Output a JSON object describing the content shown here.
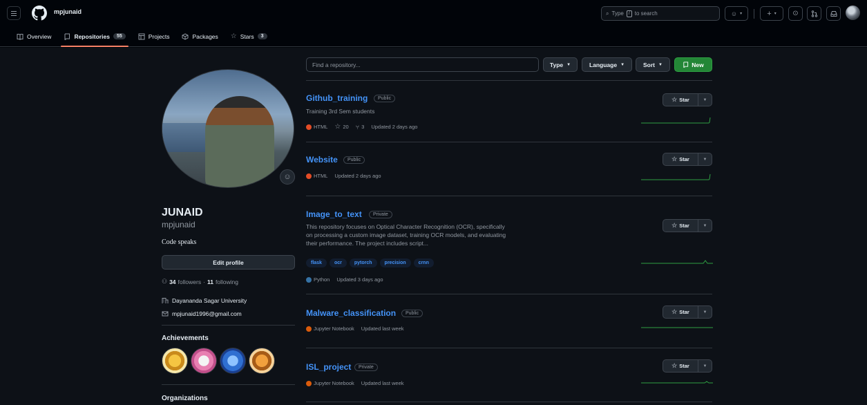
{
  "header": {
    "context_title": "mpjunaid",
    "search_placeholder_before": "Type",
    "search_key": "/",
    "search_placeholder_after": "to search"
  },
  "tabs": [
    {
      "label": "Overview"
    },
    {
      "label": "Repositories",
      "count": "55"
    },
    {
      "label": "Projects"
    },
    {
      "label": "Packages"
    },
    {
      "label": "Stars",
      "count": "3"
    }
  ],
  "profile": {
    "name": "JUNAID",
    "login": "mpjunaid",
    "bio": "Code speaks",
    "edit_label": "Edit profile",
    "followers_count": "34",
    "followers_label": "followers",
    "separator": "·",
    "following_count": "11",
    "following_label": "following",
    "organization": "Dayananda Sagar University",
    "email": "mpjunaid1996@gmail.com",
    "achievements_heading": "Achievements",
    "organizations_heading": "Organizations"
  },
  "filters": {
    "search_placeholder": "Find a repository...",
    "type_label": "Type",
    "language_label": "Language",
    "sort_label": "Sort",
    "new_label": "New"
  },
  "star_label": "Star",
  "repos": [
    {
      "name": "Github_training",
      "visibility": "Public",
      "description": "Training 3rd Sem students",
      "language": "HTML",
      "lang_color": "#e34c26",
      "stars": "20",
      "forks": "3",
      "updated": "Updated 2 days ago"
    },
    {
      "name": "Website",
      "visibility": "Public",
      "language": "HTML",
      "lang_color": "#e34c26",
      "updated": "Updated 2 days ago"
    },
    {
      "name": "Image_to_text",
      "visibility": "Private",
      "description_lines": [
        "This repository focuses on Optical Character Recognition (OCR), specifically",
        "on processing a custom image dataset, training OCR models, and evaluating",
        "their performance. The project includes script..."
      ],
      "topics": [
        "flask",
        "ocr",
        "pytorch",
        "precision",
        "crnn"
      ],
      "language": "Python",
      "lang_color": "#3572A5",
      "updated": "Updated 3 days ago"
    },
    {
      "name": "Malware_classification",
      "visibility": "Public",
      "language": "Jupyter Notebook",
      "lang_color": "#DA5B0B",
      "updated": "Updated last week"
    },
    {
      "name": "ISL_project",
      "visibility": "Private",
      "language": "Jupyter Notebook",
      "lang_color": "#DA5B0B",
      "updated": "Updated last week"
    }
  ],
  "colors": {
    "accent_link": "#4493f8",
    "new_button": "#238636",
    "tab_underline": "#f78166",
    "sparkline": "#2ea043"
  }
}
